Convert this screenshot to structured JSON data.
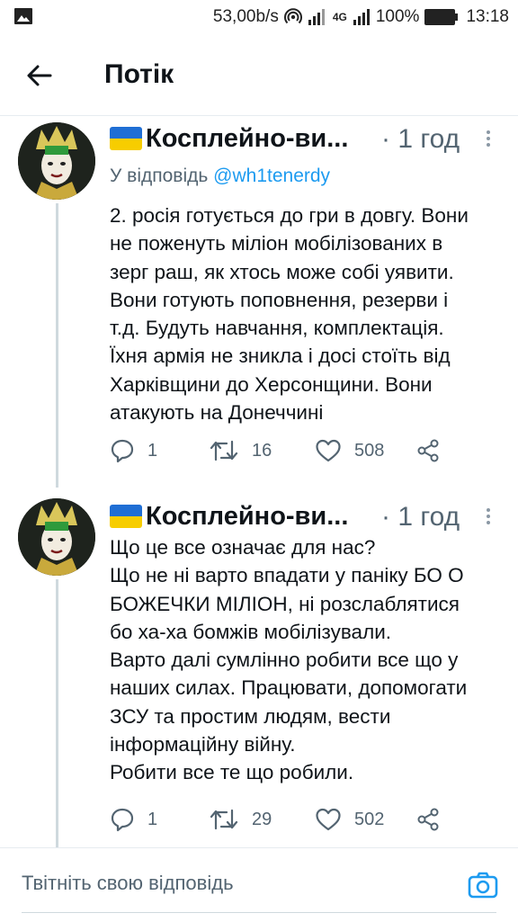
{
  "status_bar": {
    "speed": "53,00b/s",
    "network": "4G",
    "battery": "100%",
    "time": "13:18"
  },
  "header": {
    "title": "Потік"
  },
  "tweets": [
    {
      "author": "Косплейно-ви...",
      "time": "· 1 год",
      "reply_prefix": "У відповідь",
      "reply_handle": "@wh1tenerdy",
      "text": "2. росія готується до гри в довгу. Вони\nне поженуть міліон мобілізованих в\nзерг раш, як хтось може собі уявити.\nВони готують поповнення, резерви і\nт.д. Будуть навчання, комплектація.\nЇхня армія не зникла і досі стоїть від\nХарківщини до Херсонщини. Вони\nатакують на Донеччині",
      "replies": "1",
      "retweets": "16",
      "likes": "508"
    },
    {
      "author": "Косплейно-ви...",
      "time": "· 1 год",
      "text": "Що це все означає для нас?\nЩо не ні варто впадати у паніку БО О\nБОЖЕЧКИ МІЛІОН, ні розслаблятися\nбо ха-ха бомжів мобілізували.\nВарто далі сумлінно робити все що у\nнаших силах. Працювати, допомогати\nЗСУ та простим людям, вести\nінформаційну війну.\nРобити все те що робили.",
      "replies": "1",
      "retweets": "29",
      "likes": "502"
    }
  ],
  "compose": {
    "placeholder": "Твітніть свою відповідь"
  },
  "colors": {
    "accent": "#1d9bf0",
    "muted": "#536471",
    "flag_blue": "#1f6ed4",
    "flag_yellow": "#f7cd00"
  }
}
